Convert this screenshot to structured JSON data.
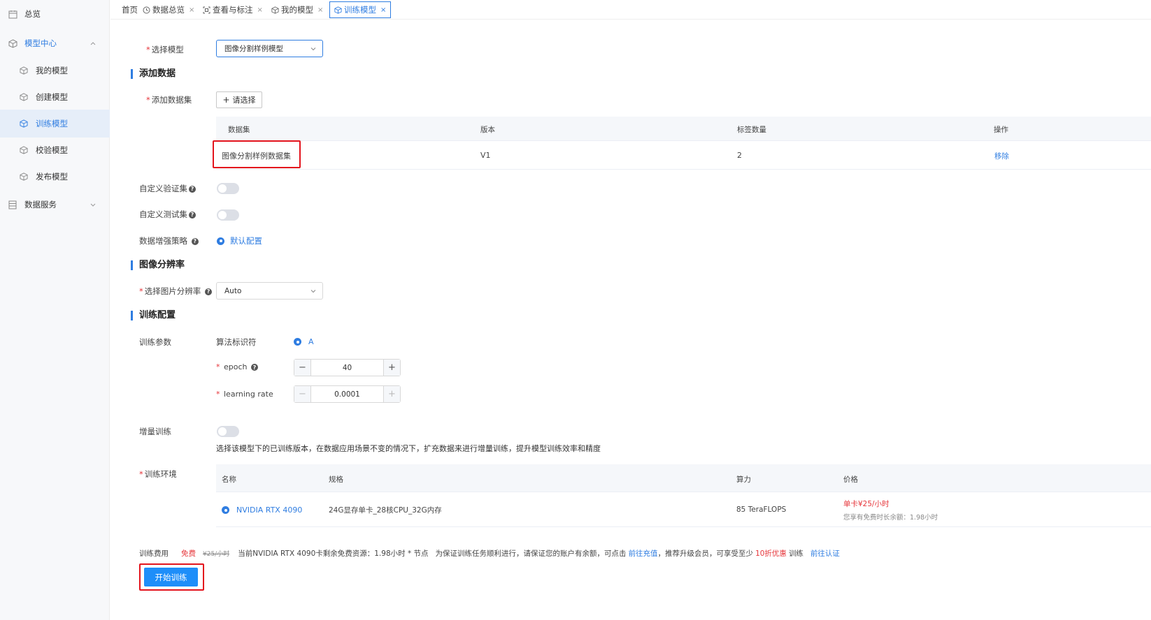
{
  "sidebar": {
    "items": [
      {
        "label": "总览"
      },
      {
        "label": "模型中心"
      },
      {
        "label": "我的模型"
      },
      {
        "label": "创建模型"
      },
      {
        "label": "训练模型"
      },
      {
        "label": "校验模型"
      },
      {
        "label": "发布模型"
      },
      {
        "label": "数据服务"
      }
    ]
  },
  "tabs": [
    {
      "label": "首页"
    },
    {
      "label": "数据总览",
      "close": "×"
    },
    {
      "label": "查看与标注",
      "close": "×"
    },
    {
      "label": "我的模型",
      "close": "×"
    },
    {
      "label": "训练模型",
      "close": "×"
    }
  ],
  "form": {
    "select_model": {
      "label": "选择模型",
      "value": "图像分割样例模型"
    },
    "add_data_section": "添加数据",
    "add_dataset": {
      "label": "添加数据集",
      "button": "请选择"
    },
    "dataset_table": {
      "columns": [
        "数据集",
        "版本",
        "标签数量",
        "操作"
      ],
      "rows": [
        {
          "name": "图像分割样例数据集",
          "version": "V1",
          "labels": "2",
          "action": "移除"
        }
      ]
    },
    "custom_val": {
      "label": "自定义验证集"
    },
    "custom_test": {
      "label": "自定义测试集"
    },
    "augment": {
      "label": "数据增强策略",
      "option": "默认配置"
    },
    "resolution_section": "图像分辨率",
    "resolution": {
      "label": "选择图片分辨率",
      "value": "Auto"
    },
    "train_section": "训练配置",
    "train_params": {
      "label": "训练参数",
      "algo_label": "算法标识符",
      "algo_value": "A",
      "epoch_label": "epoch",
      "epoch_value": "40",
      "lr_label": "learning rate",
      "lr_value": "0.0001"
    },
    "incremental": {
      "label": "增量训练",
      "desc": "选择该模型下的已训练版本，在数据应用场景不变的情况下，扩充数据来进行增量训练，提升模型训练效率和精度"
    },
    "env": {
      "label": "训练环境",
      "columns": [
        "名称",
        "规格",
        "算力",
        "价格"
      ],
      "rows": [
        {
          "name": "NVIDIA RTX 4090",
          "spec": "24G显存单卡_28核CPU_32G内存",
          "power": "85 TeraFLOPS",
          "price": "单卡¥25/小时",
          "price_note": "您享有免费时长余额：1.98小时"
        }
      ]
    },
    "fee": {
      "label": "训练费用",
      "free": "免费",
      "original": "¥25/小时",
      "info": "当前NVIDIA RTX 4090卡剩余免费资源：1.98小时 * 节点",
      "notice": "为保证训练任务顺利进行，请保证您的账户有余额，可点击",
      "recharge": "前往充值",
      "notice2": "，推荐升级会员，可享受至少",
      "discount": "10折优惠",
      "notice3": "训练",
      "certify": "前往认证"
    },
    "start_button": "开始训练"
  },
  "colors": {
    "accent": "#2f7de1",
    "primary_button": "#1e8ef9",
    "highlight_box": "#e3141d",
    "price": "#e6353a"
  }
}
